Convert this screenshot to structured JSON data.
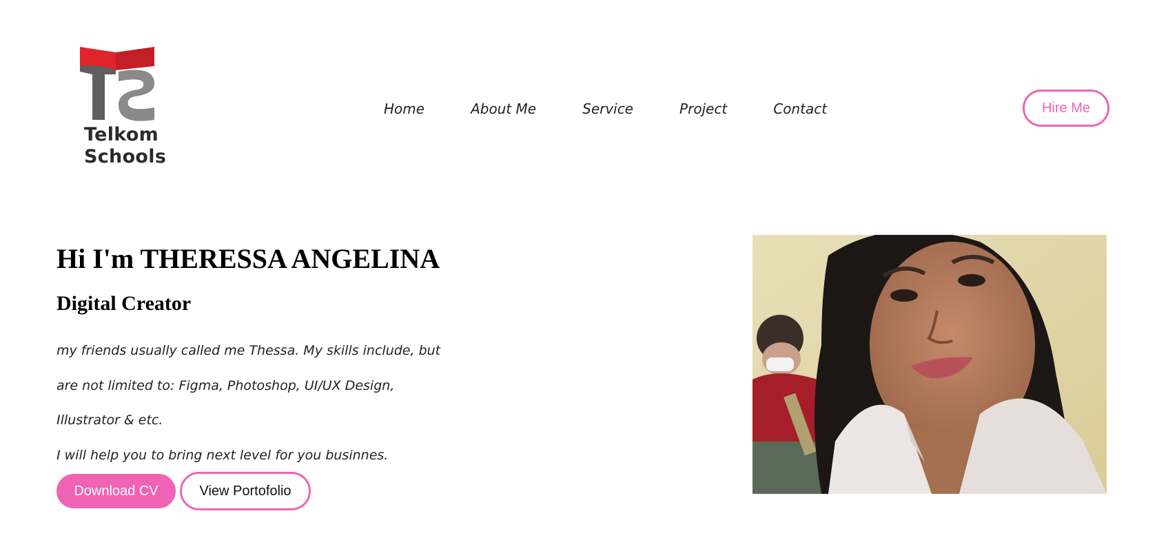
{
  "brand": {
    "line1": "Telkom",
    "line2": "Schools"
  },
  "nav": {
    "items": [
      {
        "label": "Home"
      },
      {
        "label": "About Me"
      },
      {
        "label": "Service"
      },
      {
        "label": "Project"
      },
      {
        "label": "Contact"
      }
    ]
  },
  "header": {
    "hire_label": "Hire Me"
  },
  "hero": {
    "title": "Hi I'm THERESSA ANGELINA",
    "subtitle": "Digital Creator",
    "desc_lines": [
      "my friends usually called me Thessa. My skills include, but",
      "are not limited to: Figma, Photoshop, UI/UX Design,",
      "Illustrator & etc.",
      "I will help you to bring next level for you businnes."
    ],
    "download_label": "Download CV",
    "portfolio_label": "View Portofolio"
  },
  "colors": {
    "accent": "#f063b4",
    "logo_red": "#d9262c",
    "logo_gray": "#6a6a6a"
  }
}
